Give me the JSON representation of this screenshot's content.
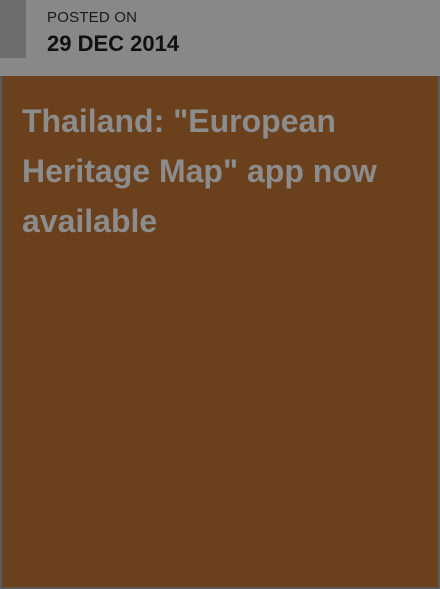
{
  "post": {
    "posted_label": "POSTED ON",
    "date": "29 DEC 2014",
    "title": "Thailand: \"European Heritage Map\" app now available"
  },
  "colors": {
    "header_bg": "#888888",
    "header_accent": "#6d6d6d",
    "body_bg": "#6b401d",
    "title_text": "#8c8c8c"
  }
}
